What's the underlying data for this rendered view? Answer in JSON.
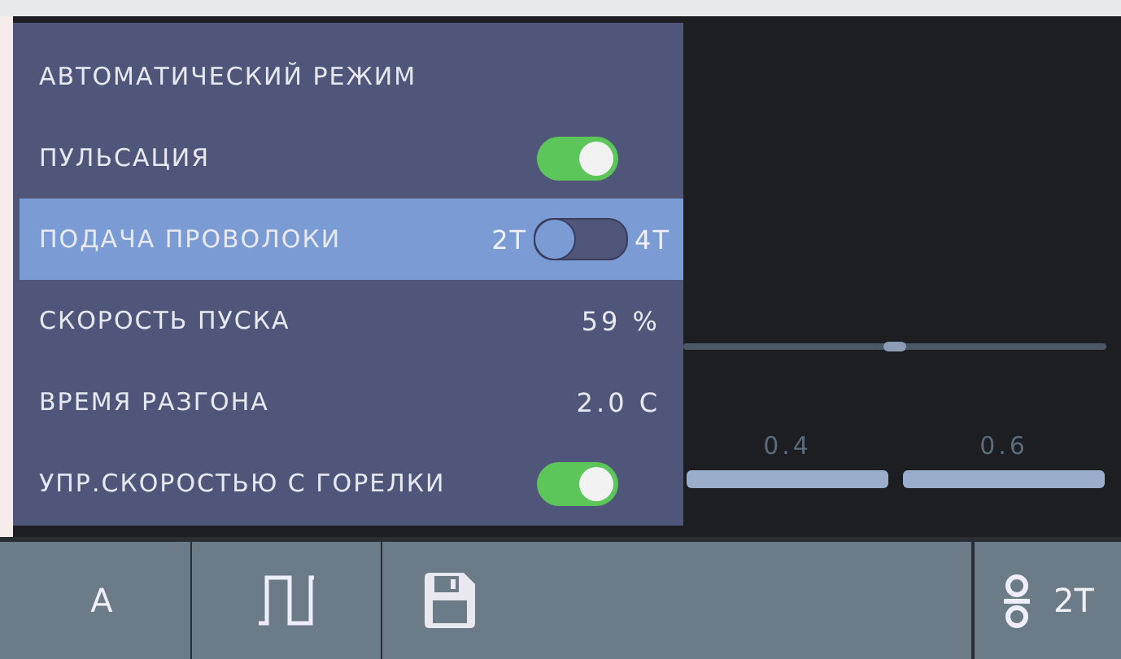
{
  "menu": {
    "rows": [
      {
        "kind": "heading",
        "label": "АВТОМАТИЧЕСКИЙ РЕЖИМ",
        "selected": false
      },
      {
        "kind": "toggle",
        "label": "ПУЛЬСАЦИЯ",
        "on": true,
        "selected": false
      },
      {
        "kind": "choice",
        "label": "ПОДАЧА ПРОВОЛОКИ",
        "left_label": "2T",
        "right_label": "4T",
        "on": false,
        "selected": true
      },
      {
        "kind": "value",
        "label": "СКОРОСТЬ ПУСКА",
        "value": "59 %",
        "selected": false
      },
      {
        "kind": "value",
        "label": "ВРЕМЯ РАЗГОНА",
        "value": "2.0 С",
        "selected": false
      },
      {
        "kind": "toggle",
        "label": "УПР.СКОРОСТЬЮ С ГОРЕЛКИ",
        "on": true,
        "selected": false
      }
    ]
  },
  "background": {
    "slider": {
      "level": 0.5
    },
    "scale_labels": [
      "0.4",
      "0.6"
    ]
  },
  "toolbar": [
    {
      "kind": "text",
      "label": "A"
    },
    {
      "kind": "pulse"
    },
    {
      "kind": "save"
    },
    {
      "kind": "wire",
      "label": "2T"
    }
  ]
}
